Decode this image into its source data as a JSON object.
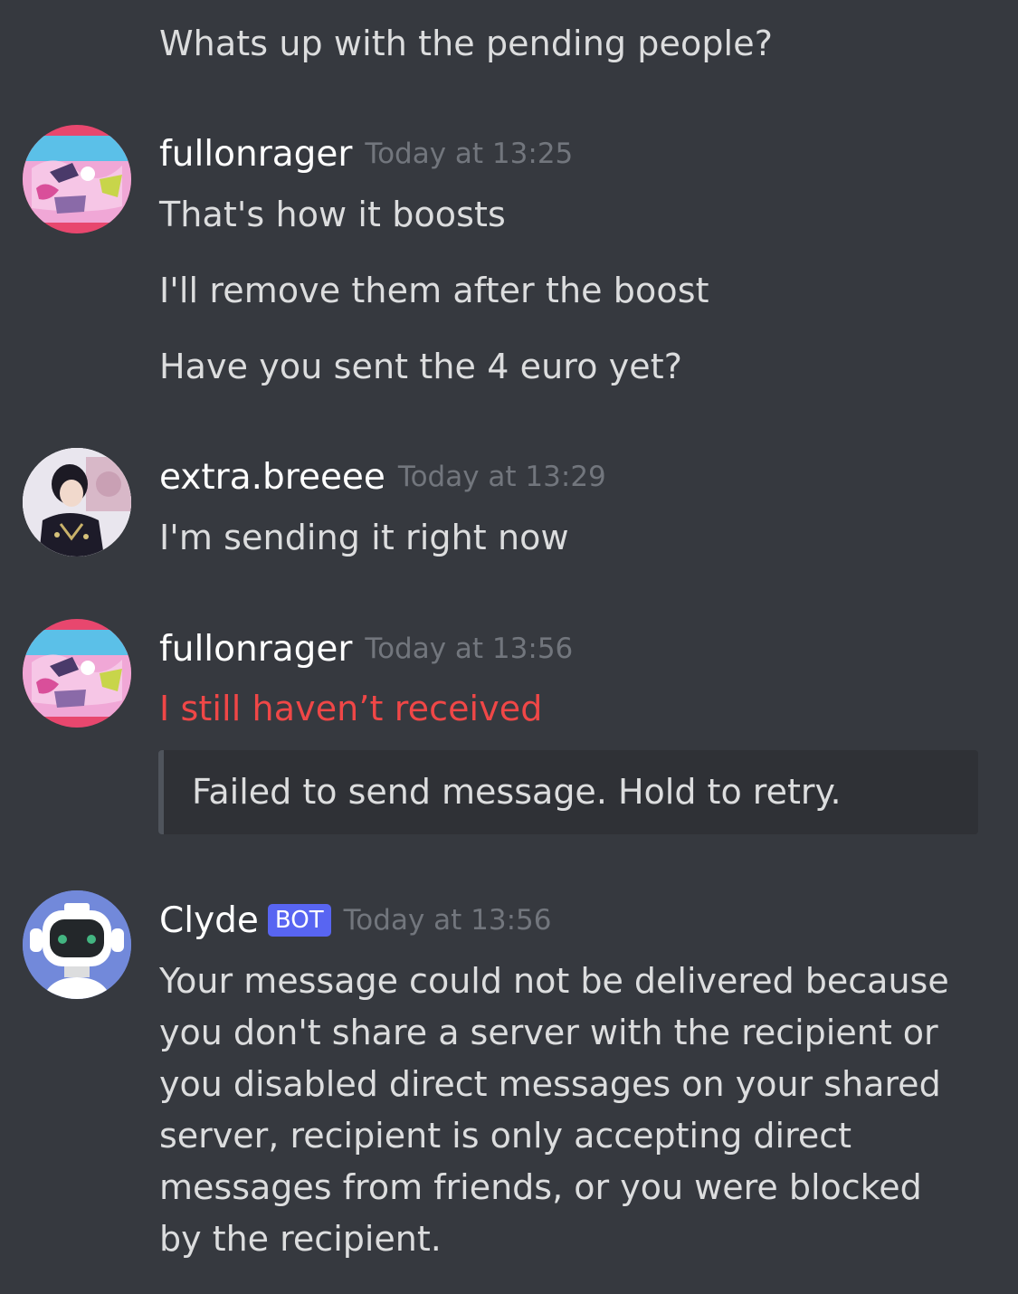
{
  "messages": {
    "top_line": "Whats up with the pending people?",
    "group1": {
      "username": "fullonrager",
      "timestamp": "Today at 13:25",
      "lines": [
        "That's how it boosts",
        "I'll remove them after the boost",
        "Have you sent the 4 euro yet?"
      ]
    },
    "group2": {
      "username": "extra.breeee",
      "timestamp": "Today at 13:29",
      "lines": [
        "I'm sending it right now"
      ]
    },
    "group3": {
      "username": "fullonrager",
      "timestamp": "Today at 13:56",
      "failed_text": "I still haven’t received",
      "failed_notice": "Failed to send message. Hold to retry."
    },
    "group4": {
      "username": "Clyde",
      "badge": "BOT",
      "timestamp": "Today at 13:56",
      "body": "Your message could not be delivered because you don't share a server with the recipient or you disabled direct messages on your shared server, recipient is only accepting direct messages from friends, or you were blocked by the recipient."
    }
  },
  "colors": {
    "background": "#36393f",
    "failed_text": "#f04747",
    "bot_badge": "#5865f2",
    "clyde_avatar": "#7289da"
  },
  "icons": {
    "avatar_fullonrager": "anime-art-avatar",
    "avatar_extra_breeee": "person-photo-avatar",
    "avatar_clyde": "robot-avatar"
  }
}
